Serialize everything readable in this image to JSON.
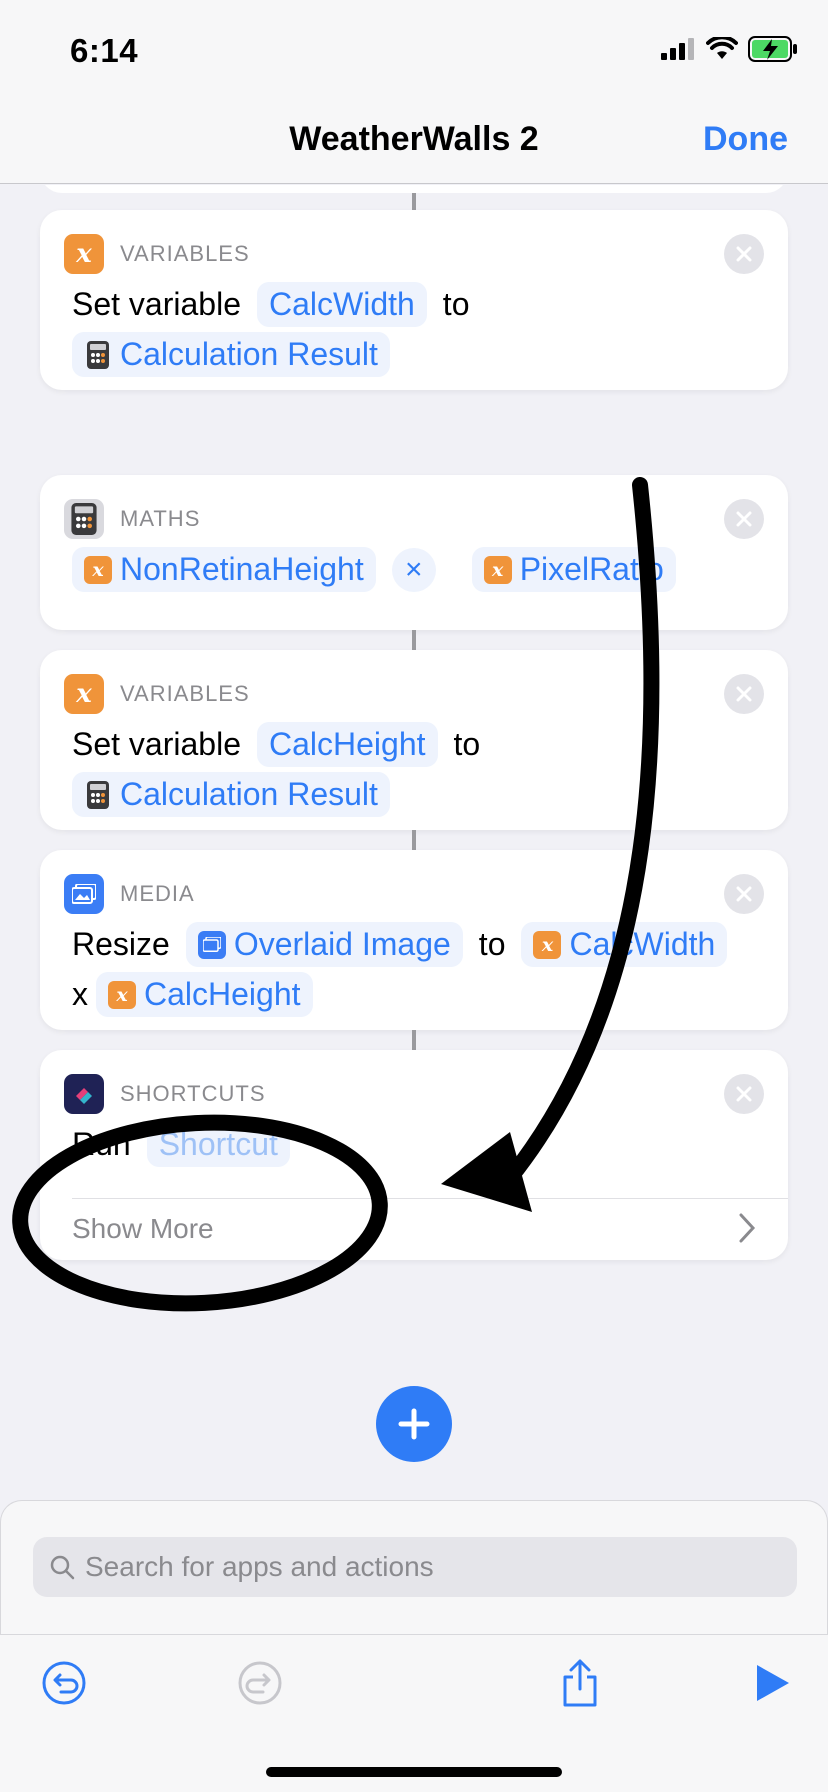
{
  "status_bar": {
    "time": "6:14"
  },
  "nav": {
    "title": "WeatherWalls 2",
    "done_label": "Done"
  },
  "cards": {
    "set_width": {
      "category": "VARIABLES",
      "verb": "Set variable",
      "variable": "CalcWidth",
      "to": "to",
      "value": "Calculation Result"
    },
    "maths": {
      "category": "MATHS",
      "operand_a": "NonRetinaHeight",
      "operator": "×",
      "operand_b": "PixelRatio"
    },
    "set_height": {
      "category": "VARIABLES",
      "verb": "Set variable",
      "variable": "CalcHeight",
      "to": "to",
      "value": "Calculation Result"
    },
    "resize": {
      "category": "MEDIA",
      "verb": "Resize",
      "image": "Overlaid Image",
      "to": "to",
      "width": "CalcWidth",
      "x": "x",
      "height": "CalcHeight"
    },
    "shortcut": {
      "category": "SHORTCUTS",
      "verb": "Run",
      "placeholder": "Shortcut",
      "show_more": "Show More"
    }
  },
  "search": {
    "placeholder": "Search for apps and actions"
  },
  "colors": {
    "accent": "#2f7cf6",
    "variable_icon": "#f0943a",
    "media_icon": "#3b7df5"
  },
  "icons": {
    "status": [
      "cellular-signal-icon",
      "wifi-icon",
      "battery-charging-icon"
    ],
    "toolbar": [
      "undo-icon",
      "redo-icon",
      "share-icon",
      "play-icon"
    ]
  }
}
